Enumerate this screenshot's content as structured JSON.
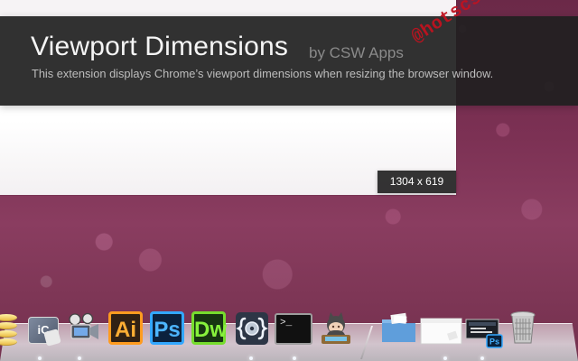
{
  "app": {
    "title": "Viewport Dimensions",
    "by_label": "by CSW Apps",
    "subtitle": "This extension displays Chrome’s viewport dimensions when resizing the browser window."
  },
  "watermark": {
    "text": "@hotscs66"
  },
  "viewport": {
    "size_label": "1304 x 619"
  },
  "dock": {
    "items": [
      {
        "name": "database-app-icon"
      },
      {
        "name": "ic-app-icon",
        "label": "iC"
      },
      {
        "name": "film-camera-icon"
      },
      {
        "name": "illustrator-icon",
        "label": "Ai"
      },
      {
        "name": "photoshop-icon",
        "label": "Ps"
      },
      {
        "name": "dreamweaver-icon",
        "label": "Dw"
      },
      {
        "name": "brackets-icon"
      },
      {
        "name": "terminal-icon",
        "label": ">_"
      },
      {
        "name": "octocat-icon"
      },
      {
        "name": "folder-icon"
      },
      {
        "name": "window-preview-icon"
      },
      {
        "name": "document-stack-icon",
        "label": "Ps"
      },
      {
        "name": "trash-icon"
      }
    ]
  },
  "colors": {
    "panel": "#1f1f1f",
    "text_primary": "#f5f5f5",
    "text_secondary": "#bdbdbd",
    "watermark": "#c1121f",
    "ai_accent": "#ff9b1f",
    "ps_accent": "#33a7ff",
    "dw_accent": "#76dd2d"
  }
}
